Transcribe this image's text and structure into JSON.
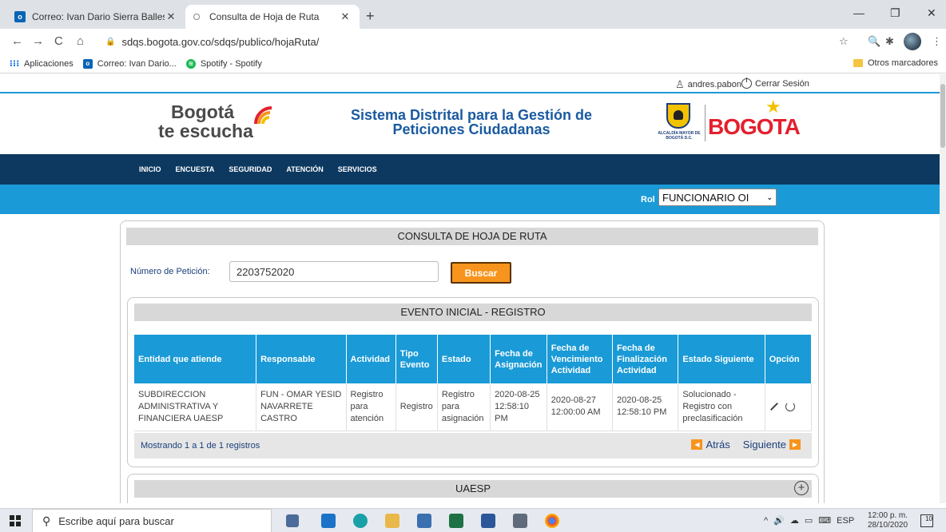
{
  "browser": {
    "tabs": [
      {
        "title": "Correo: Ivan Dario Sierra Balleste",
        "active": false
      },
      {
        "title": "Consulta de Hoja de Ruta",
        "active": true
      }
    ],
    "new_tab": "+",
    "url": "sdqs.bogota.gov.co/sdqs/publico/hojaRuta/",
    "bookmarks": [
      "Aplicaciones",
      "Correo: Ivan Dario...",
      "Spotify - Spotify"
    ],
    "other_bookmarks": "Otros marcadores"
  },
  "userbar": {
    "username": "andres.pabon",
    "logout": "Cerrar Sesión"
  },
  "header": {
    "logo_line1": "Bogotá",
    "logo_line2": "te escucha",
    "title_line1": "Sistema Distrital para la Gestión de",
    "title_line2": "Peticiones Ciudadanas",
    "alcaldia_small": "ALCALDÍA MAYOR DE BOGOTÁ D.C.",
    "alcaldia_big": "BOGOTA"
  },
  "nav": {
    "items": [
      "INICIO",
      "ENCUESTA",
      "SEGURIDAD",
      "ATENCIÓN",
      "SERVICIOS"
    ]
  },
  "role": {
    "label": "Rol",
    "value": "FUNCIONARIO OI"
  },
  "consulta": {
    "title": "CONSULTA DE HOJA DE RUTA",
    "field_label": "Número de Petición:",
    "field_value": "2203752020",
    "button": "Buscar"
  },
  "evento": {
    "title": "EVENTO INICIAL - REGISTRO",
    "columns": [
      "Entidad que atiende",
      "Responsable",
      "Actividad",
      "Tipo Evento",
      "Estado",
      "Fecha de Asignación",
      "Fecha de Vencimiento Actividad",
      "Fecha de Finalización Actividad",
      "Estado Siguiente",
      "Opción"
    ],
    "rows": [
      [
        "SUBDIRECCION ADMINISTRATIVA Y FINANCIERA UAESP",
        "FUN - OMAR YESID NAVARRETE CASTRO",
        "Registro para atención",
        "Registro",
        "Registro para asignación",
        "2020-08-25 12:58:10 PM",
        "2020-08-27 12:00:00 AM",
        "2020-08-25 12:58:10 PM",
        "Solucionado - Registro con preclasificación",
        ""
      ]
    ],
    "info": "Mostrando 1 a 1 de 1 registros",
    "prev": "Atrás",
    "next": "Siguiente"
  },
  "uaesp": {
    "title": "UAESP"
  },
  "taskbar": {
    "search_placeholder": "Escribe aquí para buscar",
    "lang": "ESP",
    "time": "12:00 p. m.",
    "date": "28/10/2020",
    "notifications": "10"
  },
  "colors": {
    "accent_blue": "#1a9ad6",
    "nav_dark": "#0d3960",
    "button_orange": "#f7941d"
  }
}
